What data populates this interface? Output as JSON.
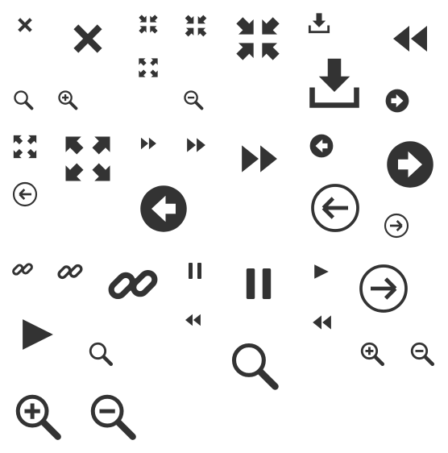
{
  "sheet": {
    "background": "#ffffff",
    "icon_color": "#333333",
    "icons": [
      "close-icon",
      "close-icon",
      "collapse-icon",
      "collapse-icon",
      "collapse-icon",
      "expand-icon",
      "download-icon",
      "download-icon",
      "rewind-icon",
      "search-icon",
      "zoom-in-icon",
      "zoom-out-icon",
      "arrow-right-circle-icon",
      "expand-icon",
      "expand-icon",
      "fast-forward-icon",
      "fast-forward-icon",
      "fast-forward-icon",
      "arrow-left-circle-icon",
      "arrow-right-circle-icon",
      "arrow-left-outline-icon",
      "arrow-left-circle-icon",
      "arrow-left-outline-icon",
      "arrow-right-outline-icon",
      "link-icon",
      "link-icon",
      "link-icon",
      "pause-icon",
      "pause-icon",
      "play-icon",
      "arrow-right-outline-icon",
      "play-icon",
      "rewind-icon",
      "rewind-icon",
      "search-icon",
      "search-icon",
      "zoom-in-icon",
      "zoom-out-icon",
      "zoom-in-icon",
      "zoom-out-icon"
    ]
  }
}
